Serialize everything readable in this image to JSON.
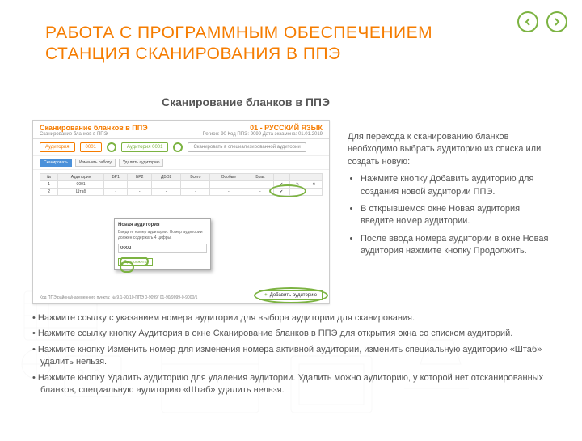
{
  "title_line1": "РАБОТА С ПРОГРАММНЫМ ОБЕСПЕЧЕНИЕМ",
  "title_line2": "СТАНЦИЯ СКАНИРОВАНИЯ В ППЭ",
  "subtitle": "Сканирование бланков в ППЭ",
  "screenshot": {
    "header_title": "Сканирование бланков в ППЭ",
    "header_sub": "Сканирование бланков в ППЭ",
    "subject": "01 - РУССКИЙ ЯЗЫК",
    "meta": "Регион: 90   Код ППЭ: 9099   Дата экзамена: 01.01.2019",
    "aud_label": "Аудитория",
    "aud_num": "0001",
    "aud_btn": "Аудитория 0001",
    "spec_btn": "Сканировать в специализированной аудитории",
    "tbtn_scan": "Сканировать",
    "tbtn_edit": "Изменить работу",
    "tbtn_del": "Удалить аудиторию",
    "dialog_title": "Новая аудитория",
    "dialog_msg": "Введите номер аудитории. Номер аудитории должен содержать 4 цифры.",
    "dialog_value": "0002",
    "dialog_ok": "Продолжить",
    "add_btn": "Добавить аудиторию",
    "bottom_meta": "Код ППЭ района/населенного пункта:\n№ 9.1-90/10-ППЭ 0-9099/ 01-90/9099-0-9000/1"
  },
  "right": {
    "intro": "Для перехода к сканированию бланков необходимо выбрать аудиторию из списка или создать новую:",
    "b1": "Нажмите кнопку Добавить аудиторию для создания новой аудитории ППЭ.",
    "b2": "В открывшемся окне Новая аудитория введите номер аудитории.",
    "b3": "После ввода номера аудитории в окне Новая аудитория нажмите кнопку Продолжить."
  },
  "bottom": {
    "p1": "•      Нажмите ссылку с указанием номера аудитории для выбора аудитории для сканирования.",
    "p2": "•      Нажмите ссылку кнопку Аудитория в окне Сканирование бланков в ППЭ для открытия окна со списком аудиторий.",
    "p3": "•      Нажмите кнопку Изменить номер для изменения номера активной аудитории, изменить специальную аудиторию «Штаб»     удалить нельзя.",
    "p4": "•      Нажмите кнопку Удалить аудиторию для удаления аудитории. Удалить можно аудиторию, у которой нет отсканированных бланков, специальную аудиторию «Штаб» удалить нельзя."
  }
}
